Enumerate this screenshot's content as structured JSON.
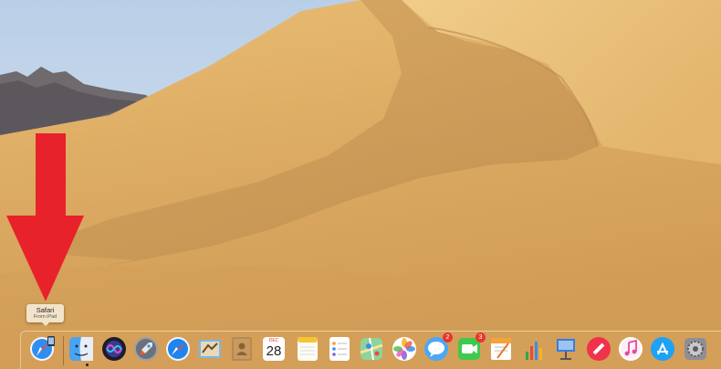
{
  "tooltip": {
    "title": "Safari",
    "subtitle": "From iPad"
  },
  "dock": {
    "items": [
      {
        "name": "safari-from-ipad",
        "icon": "safari-ipad-icon",
        "running": false
      },
      {
        "name": "finder",
        "icon": "finder-icon",
        "running": true
      },
      {
        "name": "siri",
        "icon": "siri-icon",
        "running": false
      },
      {
        "name": "launchpad",
        "icon": "launchpad-icon",
        "running": false
      },
      {
        "name": "safari",
        "icon": "safari-icon",
        "running": false
      },
      {
        "name": "mail",
        "icon": "mail-icon",
        "running": false
      },
      {
        "name": "contacts",
        "icon": "contacts-icon",
        "running": false
      },
      {
        "name": "calendar",
        "icon": "calendar-icon",
        "running": false
      },
      {
        "name": "notes",
        "icon": "notes-icon",
        "running": false
      },
      {
        "name": "reminders",
        "icon": "reminders-icon",
        "running": false
      },
      {
        "name": "maps",
        "icon": "maps-icon",
        "running": false
      },
      {
        "name": "photos",
        "icon": "photos-icon",
        "running": false
      },
      {
        "name": "messages",
        "icon": "messages-icon",
        "running": false
      },
      {
        "name": "facetime",
        "icon": "facetime-icon",
        "running": false
      },
      {
        "name": "pages",
        "icon": "pages-icon",
        "running": false
      },
      {
        "name": "numbers",
        "icon": "numbers-icon",
        "running": false
      },
      {
        "name": "keynote",
        "icon": "keynote-icon",
        "running": false
      },
      {
        "name": "news",
        "icon": "news-icon",
        "running": false
      },
      {
        "name": "itunes",
        "icon": "itunes-icon",
        "running": false
      },
      {
        "name": "app-store",
        "icon": "app-store-icon",
        "running": false
      },
      {
        "name": "system-preferences",
        "icon": "gear-icon",
        "running": false
      }
    ],
    "calendar": {
      "month": "DEC",
      "day": "28"
    },
    "messages_badge": "2",
    "facetime_badge": "3"
  },
  "colors": {
    "sky": "#c9d8ea",
    "dune": "#d6a45c",
    "arrow": "#e8222a",
    "badge": "#e8362c"
  }
}
